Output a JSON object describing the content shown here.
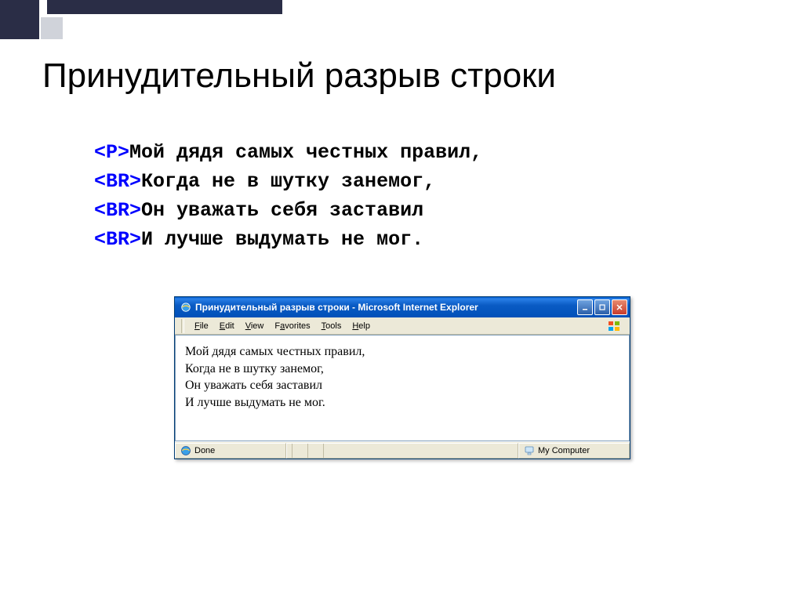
{
  "slide": {
    "title": "Принудительный разрыв строки"
  },
  "code": {
    "tag_p": "<P>",
    "tag_br": "<BR>",
    "line1": "Мой дядя самых честных правил,",
    "line2": "Когда не в шутку занемог,",
    "line3": "Он уважать себя заставил",
    "line4": "И лучше выдумать не мог."
  },
  "browser": {
    "title": "Принудительный разрыв строки - Microsoft Internet Explorer",
    "menu": {
      "file": "File",
      "edit": "Edit",
      "view": "View",
      "favorites": "Favorites",
      "tools": "Tools",
      "help": "Help"
    },
    "content": {
      "line1": "Мой дядя самых честных правил,",
      "line2": "Когда не в шутку занемог,",
      "line3": "Он уважать себя заставил",
      "line4": "И лучше выдумать не мог."
    },
    "status": {
      "done": "Done",
      "zone": "My Computer"
    }
  }
}
